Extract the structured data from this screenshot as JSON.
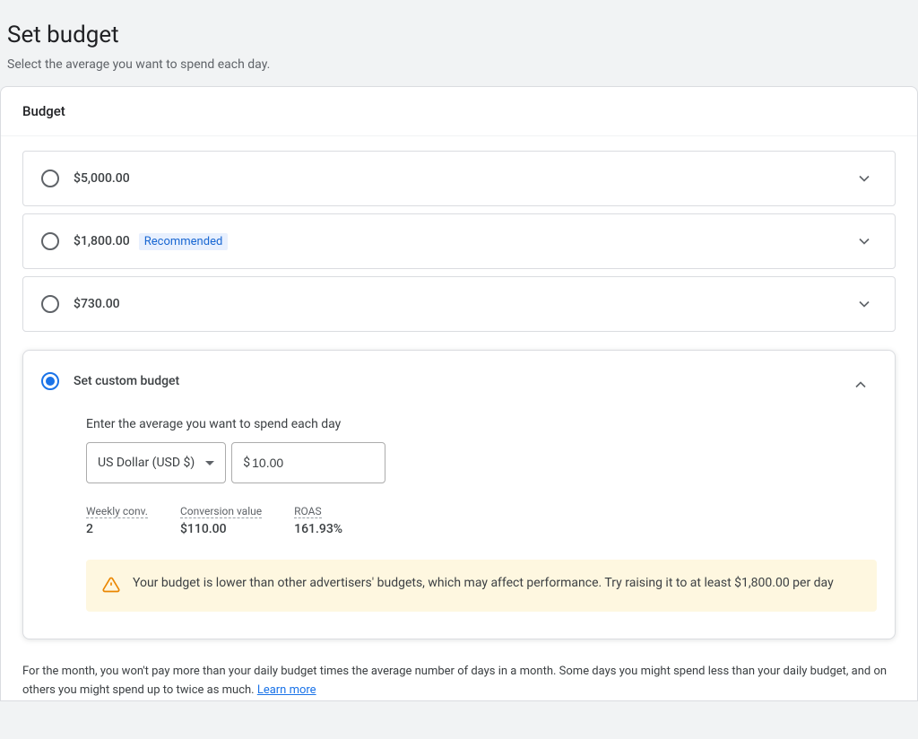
{
  "header": {
    "title": "Set budget",
    "subtitle": "Select the average you want to spend each day."
  },
  "section": {
    "title": "Budget"
  },
  "options": [
    {
      "amount": "$5,000.00",
      "recommended": false
    },
    {
      "amount": "$1,800.00",
      "recommended": true,
      "recommended_label": "Recommended"
    },
    {
      "amount": "$730.00",
      "recommended": false
    }
  ],
  "custom": {
    "label": "Set custom budget",
    "instruction": "Enter the average you want to spend each day",
    "currency_label": "US Dollar (USD $)",
    "amount_prefix": "$",
    "amount_value": "10.00"
  },
  "metrics": {
    "weekly_conv": {
      "label": "Weekly conv.",
      "value": "2"
    },
    "conversion_value": {
      "label": "Conversion value",
      "value": "$110.00"
    },
    "roas": {
      "label": "ROAS",
      "value": "161.93%"
    }
  },
  "warning": {
    "text": "Your budget is lower than other advertisers' budgets, which may affect performance. Try raising it to at least $1,800.00 per day"
  },
  "footer": {
    "text": "For the month, you won't pay more than your daily budget times the average number of days in a month. Some days you might spend less than your daily budget, and on others you might spend up to twice as much. ",
    "link_text": "Learn more"
  }
}
